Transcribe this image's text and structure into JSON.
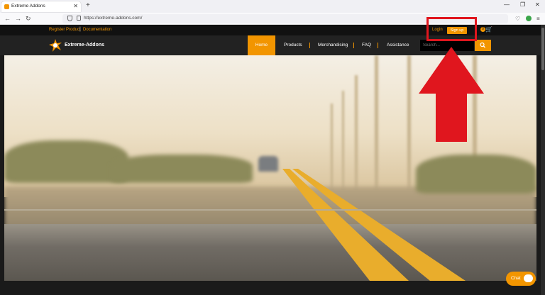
{
  "browser": {
    "tab_title": "Extreme Addons",
    "tab_close": "✕",
    "new_tab": "+",
    "url": "https://extreme-addons.com/",
    "back": "←",
    "forward": "→",
    "reload": "↻",
    "min": "—",
    "max": "❐",
    "close": "✕"
  },
  "topbar": {
    "register": "Register Product",
    "separator": "|",
    "documentation": "Documentation",
    "login": "Login",
    "signup": "Sign up",
    "cart_count": "0"
  },
  "header": {
    "logo_text": "Extreme-Addons",
    "menu": [
      "Home",
      "Products",
      "Merchandising",
      "FAQ",
      "Assistance"
    ],
    "search_placeholder": "Search..."
  },
  "chat": {
    "label": "Chat"
  },
  "colors": {
    "accent": "#f29500",
    "annotation": "#e0161e"
  }
}
